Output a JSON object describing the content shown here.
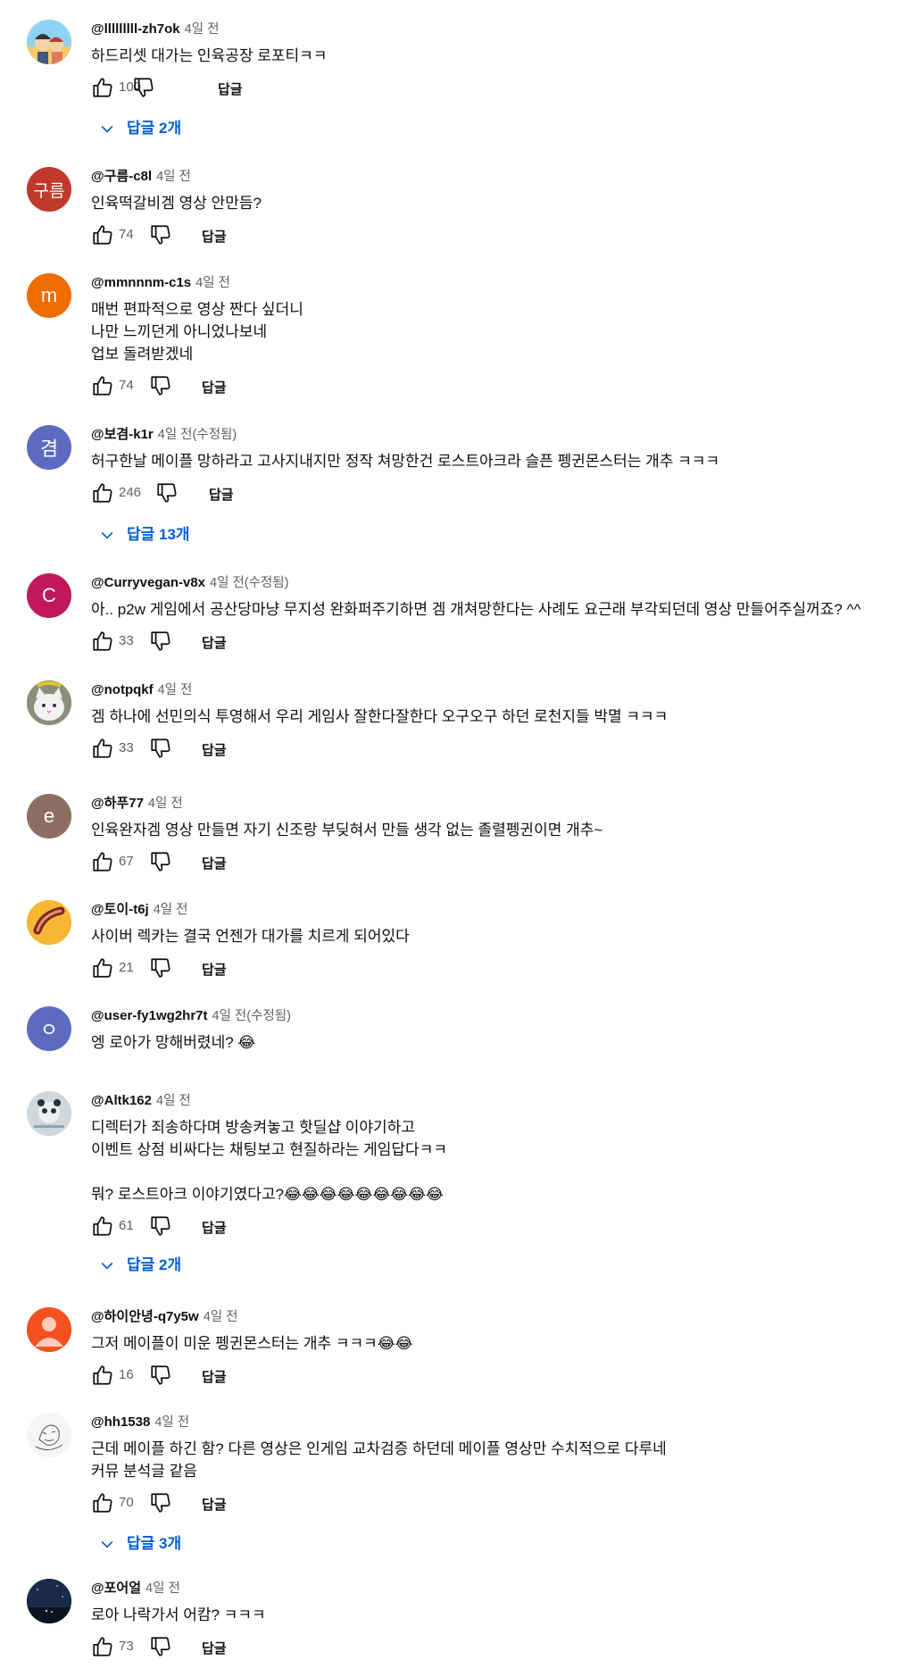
{
  "ui": {
    "reply_label": "답글",
    "accent_color": "#065fd4"
  },
  "comments": [
    {
      "author": "@lllllllll-zh7ok",
      "time": "4일 전",
      "text": "하드리셋 대가는 인육공장 로포티ㅋㅋ",
      "likes": "100",
      "avatar_icon": "cartoon-couple-avatar",
      "avatar_color": "#f4c96b",
      "replies": "답글 2개"
    },
    {
      "author": "@구름-c8l",
      "time": "4일 전",
      "text": "인육떡갈비겜 영상 안만듬?",
      "likes": "74",
      "avatar_letter": "구름",
      "avatar_color": "#c0392b"
    },
    {
      "author": "@mmnnnm-c1s",
      "time": "4일 전",
      "text": "매번 편파적으로 영상 짠다 싶더니\n나만 느끼던게 아니었나보네\n업보 돌려받겠네",
      "likes": "74",
      "avatar_letter": "m",
      "avatar_color": "#ef6c00"
    },
    {
      "author": "@보겸-k1r",
      "time": "4일 전(수정됨)",
      "text": "허구한날 메이플 망하라고 고사지내지만 정작 쳐망한건 로스트아크라 슬픈 펭귄몬스터는 개추 ㅋㅋㅋ",
      "likes": "246",
      "avatar_letter": "겸",
      "avatar_color": "#5c6bc0",
      "replies": "답글 13개"
    },
    {
      "author": "@Curryvegan-v8x",
      "time": "4일 전(수정됨)",
      "text": "아.. p2w 게임에서 공산당마냥 무지성 완화퍼주기하면 겜 개쳐망한다는 사례도 요근래 부각되던데 영상 만들어주실꺼죠? ^^",
      "likes": "33",
      "avatar_letter": "C",
      "avatar_color": "#c2185b"
    },
    {
      "author": "@notpqkf",
      "time": "4일 전",
      "text": "겜 하나에 선민의식 투영해서 우리 게임사 잘한다잘한다 오구오구 하던 로천지들 박멸 ㅋㅋㅋ",
      "likes": "33",
      "avatar_icon": "white-cat-avatar",
      "avatar_color": "#9e9e9e"
    },
    {
      "author": "@하푸77",
      "time": "4일 전",
      "text": "인육완자겜 영상 만들면 자기 신조랑 부딪혀서 만들 생각 없는 졸렬펭귄이면 개추~",
      "likes": "67",
      "avatar_letter": "e",
      "avatar_color": "#8d6e63"
    },
    {
      "author": "@토이-t6j",
      "time": "4일 전",
      "text": "사이버 렉카는 결국 언젠가 대가를 치르게 되어있다",
      "likes": "21",
      "avatar_icon": "bacon-avatar",
      "avatar_color": "#f7b733"
    },
    {
      "author": "@user-fy1wg2hr7t",
      "time": "4일 전(수정됨)",
      "text": "엥 로아가 망해버렸네? 😂",
      "likes": "",
      "avatar_letter": "ㅇ",
      "avatar_color": "#5c6bc0"
    },
    {
      "author": "@Altk162",
      "time": "4일 전",
      "text": "디렉터가 죄송하다며 방송켜놓고 핫딜샵 이야기하고\n이벤트 상점 비싸다는 채팅보고 현질하라는 게임답다ㅋㅋ\n\n뭐? 로스트아크 이야기였다고?😂😂😂😂😂😂😂😂😂",
      "likes": "61",
      "avatar_icon": "panda-photo-avatar",
      "avatar_color": "#cfd8dc",
      "replies": "답글 2개"
    },
    {
      "author": "@하이안녕-q7y5w",
      "time": "4일 전",
      "text": "그저 메이플이 미운 펭귄몬스터는 개추 ㅋㅋㅋ😂😂",
      "likes": "16",
      "avatar_icon": "default-person-avatar",
      "avatar_color": "#f4511e"
    },
    {
      "author": "@hh1538",
      "time": "4일 전",
      "text": "근데 메이플 하긴 함? 다른 영상은 인게임 교차검증 하던데 메이플 영상만 수치적으로 다루네\n커뮤 분석글 같음",
      "likes": "70",
      "avatar_icon": "sketch-drawing-avatar",
      "avatar_color": "#f5f5f5",
      "replies": "답글 3개"
    },
    {
      "author": "@포어얼",
      "time": "4일 전",
      "text": "로아 나락가서 어캄? ㅋㅋㅋ",
      "likes": "73",
      "avatar_icon": "night-sky-avatar",
      "avatar_color": "#1a2a4a"
    }
  ]
}
